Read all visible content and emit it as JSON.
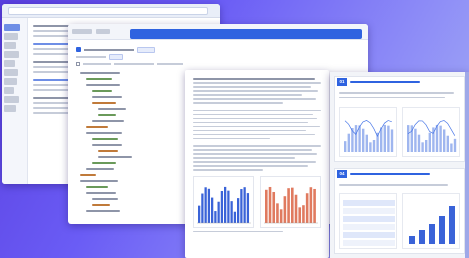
{
  "back_window": {
    "sidebar": [
      "",
      "",
      "",
      "",
      "",
      "",
      "",
      "",
      "",
      "",
      "",
      ""
    ]
  },
  "middle_window": {
    "section_num_1": "01",
    "section_num_4": "04"
  },
  "slide_panel": {
    "sections": [
      {
        "num": "01"
      },
      {
        "num": "04"
      }
    ]
  },
  "colors": {
    "accent": "#2f63e0",
    "bar": "#3a63d8",
    "bar_alt": "#e07a5f",
    "line": "#4a78e8"
  }
}
